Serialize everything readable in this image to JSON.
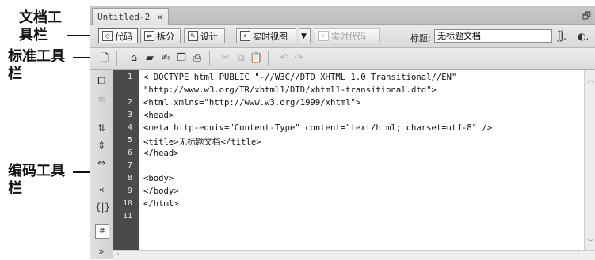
{
  "annotations": {
    "doc_toolbar": [
      "文档工",
      "具栏"
    ],
    "std_toolbar": [
      "标准工具",
      "栏"
    ],
    "code_toolbar": [
      "编码工具",
      "栏"
    ]
  },
  "tab": {
    "title": "Untitled-2",
    "close": "×"
  },
  "window_menu_icon": "restore-icon",
  "doc_toolbar": {
    "code": "代码",
    "split": "拆分",
    "design": "设计",
    "live_view": "实时视图",
    "live_code": "实时代码",
    "title_label": "标题:",
    "title_value": "无标题文档"
  },
  "code": {
    "line_numbers": [
      "1",
      "2",
      "3",
      "4",
      "5",
      "6",
      "7",
      "8",
      "9",
      "10",
      "11"
    ],
    "lines": [
      "<!DOCTYPE html PUBLIC \"-//W3C//DTD XHTML 1.0 Transitional//EN\"",
      "\"http://www.w3.org/TR/xhtml1/DTD/xhtml1-transitional.dtd\">",
      "<html xmlns=\"http://www.w3.org/1999/xhtml\">",
      "<head>",
      "<meta http-equiv=\"Content-Type\" content=\"text/html; charset=utf-8\" />",
      "<title>无标题文档</title>",
      "</head>",
      "",
      "<body>",
      "</body>",
      "</html>"
    ]
  }
}
